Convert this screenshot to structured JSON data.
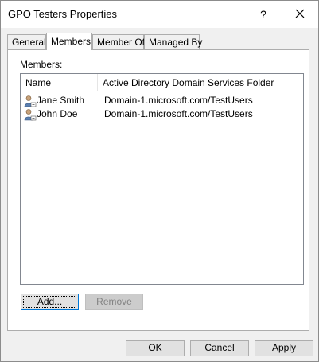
{
  "window": {
    "title": "GPO Testers Properties",
    "help_glyph": "?"
  },
  "tabs": [
    {
      "label": "General",
      "active": false
    },
    {
      "label": "Members",
      "active": true
    },
    {
      "label": "Member Of",
      "active": false
    },
    {
      "label": "Managed By",
      "active": false
    }
  ],
  "members_panel": {
    "label": "Members:",
    "columns": [
      "Name",
      "Active Directory Domain Services Folder"
    ],
    "rows": [
      {
        "name": "Jane Smith",
        "folder": "Domain-1.microsoft.com/TestUsers",
        "icon": "user-icon"
      },
      {
        "name": "John Doe",
        "folder": "Domain-1.microsoft.com/TestUsers",
        "icon": "user-icon"
      }
    ],
    "add_label": "Add...",
    "remove_label": "Remove"
  },
  "footer": {
    "ok_label": "OK",
    "cancel_label": "Cancel",
    "apply_label": "Apply"
  },
  "colors": {
    "accent": "#0078d7",
    "window_bg": "#f0f0f0"
  }
}
